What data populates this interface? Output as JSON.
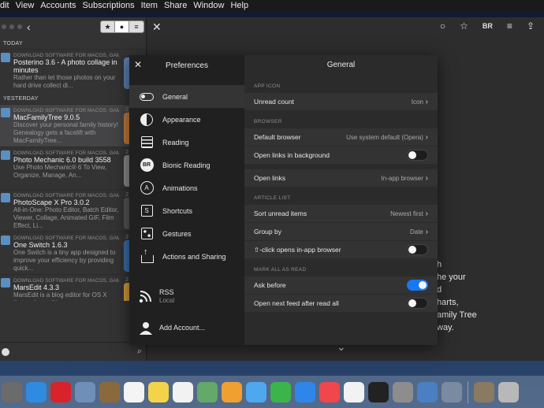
{
  "menubar": {
    "items": [
      "dit",
      "View",
      "Accounts",
      "Subscriptions",
      "Item",
      "Share",
      "Window",
      "Help"
    ]
  },
  "article_list": {
    "toolbar": {
      "back_icon": "chevron-left-icon",
      "segments": [
        "star-icon",
        "dot-icon",
        "list-icon"
      ]
    },
    "groups": [
      {
        "day": "TODAY",
        "articles": [
          {
            "source": "DOWNLOAD SOFTWARE FOR MACOS, GAME...",
            "title": "Posterino 3.6 - A photo collage in minutes",
            "summary": "Rather than let those photos on your hard drive collect di...",
            "number": "",
            "color": "#5c7fb0"
          }
        ]
      },
      {
        "day": "YESTERDAY",
        "articles": [
          {
            "source": "DOWNLOAD SOFTWARE FOR MACOS, GAME...",
            "title": "MacFamilyTree 9.0.5",
            "summary": "Discover your personal family history! Genealogy gets a facelift with MacFamilyTree...",
            "number": "2",
            "color": "#c07a3a"
          },
          {
            "source": "DOWNLOAD SOFTWARE FOR MACOS, GAME...",
            "title": "Photo Mechanic 6.0 build 3558",
            "summary": "Use Photo Mechanic® 6 To View, Organize, Manage, An...",
            "number": "2",
            "color": "#8a8a8a"
          },
          {
            "source": "DOWNLOAD SOFTWARE FOR MACOS, GAME...",
            "title": "PhotoScape X Pro 3.0.2",
            "summary": "All-in-One: Photo Editor, Batch Editor, Viewer, Collage, Animated GIF, Film Effect, Li...",
            "number": "2",
            "color": "#555555"
          },
          {
            "source": "DOWNLOAD SOFTWARE FOR MACOS, GAME...",
            "title": "One Switch 1.6.3",
            "summary": "One Switch is a tiny app designed to improve your efficiency by providing quick...",
            "number": "2",
            "color": "#3a6ea5"
          },
          {
            "source": "DOWNLOAD SOFTWARE FOR MACOS, GAME...",
            "title": "MarsEdit 4.3.3",
            "summary": "MarsEdit is a blog editor for OS X that makes editing your",
            "number": "2",
            "color": "#d49a3a"
          }
        ]
      }
    ]
  },
  "reader": {
    "tools": [
      "circle-icon",
      "star-icon",
      "BR",
      "lines-icon",
      "share-icon"
    ],
    "visible_text": "h\nhe your\nd\nharts,\namily Tree\nway."
  },
  "preferences": {
    "title": "Preferences",
    "nav": [
      {
        "label": "General",
        "icon": "toggle-icon",
        "active": true
      },
      {
        "label": "Appearance",
        "icon": "half-circle-icon"
      },
      {
        "label": "Reading",
        "icon": "reading-icon"
      },
      {
        "label": "Bionic Reading",
        "icon": "bionic-reading-icon"
      },
      {
        "label": "Animations",
        "icon": "animations-icon"
      },
      {
        "label": "Shortcuts",
        "icon": "shortcuts-icon"
      },
      {
        "label": "Gestures",
        "icon": "gestures-icon"
      },
      {
        "label": "Actions and Sharing",
        "icon": "share-icon"
      }
    ],
    "accounts": {
      "rss_label": "RSS",
      "rss_sub": "Local",
      "add_account": "Add Account..."
    },
    "general": {
      "title": "General",
      "app_icon": {
        "section": "APP ICON",
        "unread_count": {
          "label": "Unread count",
          "value": "Icon"
        }
      },
      "browser": {
        "section": "BROWSER",
        "default_browser": {
          "label": "Default browser",
          "value": "Use system default (Opera)"
        },
        "open_links_bg": {
          "label": "Open links in background",
          "on": false
        },
        "open_links": {
          "label": "Open links",
          "value": "In-app browser"
        }
      },
      "article_list": {
        "section": "ARTICLE LIST",
        "sort_unread": {
          "label": "Sort unread items",
          "value": "Newest first"
        },
        "group_by": {
          "label": "Group by",
          "value": "Date"
        },
        "shift_click": {
          "label": "⇧-click opens in-app browser",
          "on": false
        }
      },
      "mark_all": {
        "section": "MARK ALL AS READ",
        "ask_before": {
          "label": "Ask before",
          "on": true
        },
        "open_next": {
          "label": "Open next feed after read all",
          "on": false
        }
      }
    }
  },
  "dock": {
    "icons": [
      {
        "name": "launchpad-icon",
        "color": "#6b6b6b"
      },
      {
        "name": "safari-icon",
        "color": "#2e8be0"
      },
      {
        "name": "opera-icon",
        "color": "#d8232a"
      },
      {
        "name": "airplane-app-icon",
        "color": "#6d8fb8"
      },
      {
        "name": "notes-folder-icon",
        "color": "#8a6a3c"
      },
      {
        "name": "calendar-icon",
        "color": "#f4f4f4"
      },
      {
        "name": "notes-icon",
        "color": "#f3d34a"
      },
      {
        "name": "reminders-icon",
        "color": "#f2f2f2"
      },
      {
        "name": "maps-icon",
        "color": "#64a86a"
      },
      {
        "name": "photos-icon",
        "color": "#f0a030"
      },
      {
        "name": "messages-icon",
        "color": "#4ea8f0"
      },
      {
        "name": "facetime-icon",
        "color": "#3bb54a"
      },
      {
        "name": "app-store-icon",
        "color": "#2f86ea"
      },
      {
        "name": "news-icon",
        "color": "#f0464c"
      },
      {
        "name": "music-icon",
        "color": "#f2f2f2"
      },
      {
        "name": "terminal-icon",
        "color": "#222222"
      },
      {
        "name": "system-preferences-icon",
        "color": "#8d8d8d"
      },
      {
        "name": "reeder-icon",
        "color": "#4a7fc2"
      },
      {
        "name": "preview-icon",
        "color": "#7a8aa0"
      },
      {
        "name": "archive-icon",
        "color": "#8a7a62"
      },
      {
        "name": "trash-icon",
        "color": "#b8b8b8"
      }
    ]
  }
}
